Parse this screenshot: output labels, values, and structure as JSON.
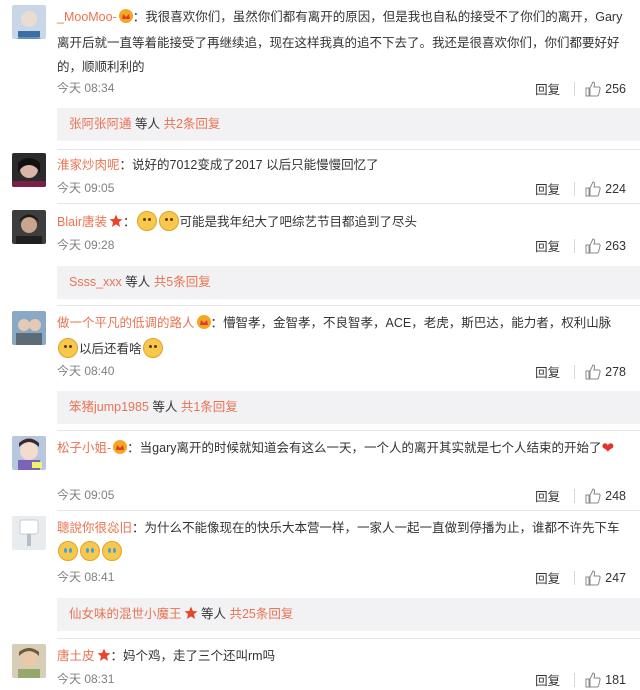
{
  "colors": {
    "username": "#eb7350",
    "text": "#333333",
    "meta": "#808080",
    "subbox_bg": "#f2f2f5"
  },
  "comments": [
    {
      "user": "_MooMoo-",
      "badge": "crown-icon",
      "text": "：我很喜欢你们，虽然你们都有离开的原因，但是我也自私的接受不了你们的离开，Gary离开后就一直等着能接受了再继续追，现在这样我真的追不下去了。我还是很喜欢你们，你们都要好好的，顺顺利利的",
      "time": "今天 08:34",
      "reply": "回复",
      "likes": "256"
    },
    {
      "user": "淮家炒肉呢",
      "text": "：说好的7012变成了2017 以后只能慢慢回忆了",
      "time": "今天 09:05",
      "reply": "回复",
      "likes": "224"
    },
    {
      "user": "Blair唐装",
      "badge": "star-icon",
      "text_after": "可能是我年纪大了吧综艺节目都追到了尽头",
      "time": "今天 09:28",
      "reply": "回复",
      "likes": "263"
    },
    {
      "user": "做一个平凡的低调的路人",
      "badge": "crown-icon",
      "text": "：懵智孝，金智孝，不良智孝，ACE，老虎，斯巴达，能力者，权利山脉",
      "text_after": "以后还看啥",
      "time": "今天 08:40",
      "reply": "回复",
      "likes": "278"
    },
    {
      "user": "松子小姐-",
      "badge": "crown-icon",
      "text": "：当gary离开的时候就知道会有这么一天，一个人的离开其实就是七个人结束的开始了",
      "time": "今天 09:05",
      "reply": "回复",
      "likes": "248"
    },
    {
      "user": "聰說你很惢旧",
      "text": "：为什么不能像现在的快乐大本营一样，一家人一起一直做到停播为止，谁都不许先下车",
      "time": "今天 08:41",
      "reply": "回复",
      "likes": "247"
    },
    {
      "user": "唐土皮",
      "badge": "star-icon",
      "text": "：妈个鸡，走了三个还叫rm吗",
      "time": "今天 08:31",
      "reply": "回复",
      "likes": "181"
    }
  ],
  "subreplies": [
    {
      "users": "张阿张阿通",
      "mid": " 等人 ",
      "count": "共2条回复"
    },
    {
      "users": "Ssss_xxx",
      "mid": " 等人 ",
      "count": "共5条回复"
    },
    {
      "users": "笨猪jump1985",
      "mid": " 等人 ",
      "count": "共1条回复"
    },
    {
      "users": "仙女味的混世小魔王",
      "mid": " 等人 ",
      "count": "共25条回复"
    }
  ]
}
